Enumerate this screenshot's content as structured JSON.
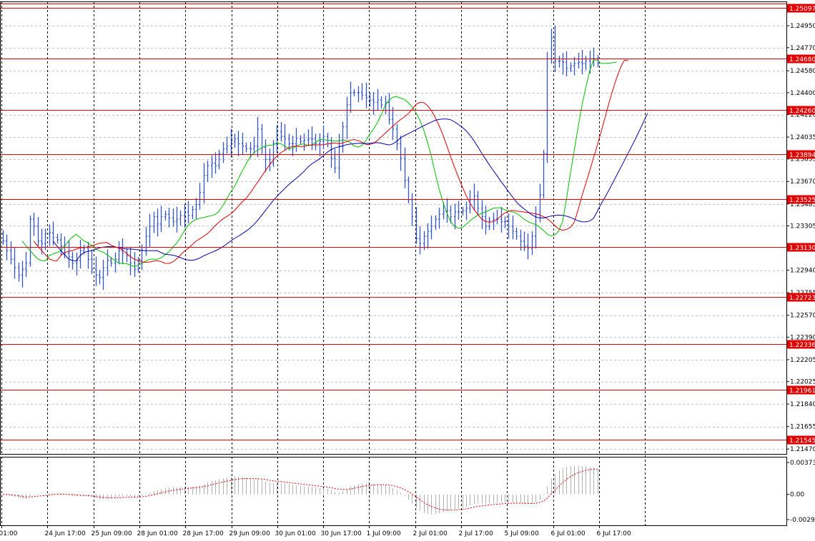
{
  "chart_data": [
    {
      "type": "candlestick",
      "y_ticks": [
        "1.24950",
        "1.24770",
        "1.24580",
        "1.24400",
        "1.24220",
        "1.24035",
        "1.23855",
        "1.23670",
        "1.23485",
        "1.23305",
        "1.22940",
        "1.22755",
        "1.22570",
        "1.22390",
        "1.22205",
        "1.22025",
        "1.21840",
        "1.21655",
        "1.21470"
      ],
      "levels": [
        "1.25097",
        "1.24680",
        "1.24260",
        "1.23894",
        "1.23525",
        "1.23130",
        "1.22723",
        "1.22336",
        "1.21961",
        "1.21545"
      ],
      "ylim": [
        1.2143,
        1.2515
      ],
      "x_ticks": [
        "01:00",
        "24 Jun 17:00",
        "25 Jun 09:00",
        "28 Jun 01:00",
        "28 Jun 17:00",
        "29 Jun 09:00",
        "30 Jun 01:00",
        "30 Jun 17:00",
        "1 Jul 09:00",
        "2 Jul 01:00",
        "2 Jul 17:00",
        "5 Jul 09:00",
        "6 Jul 01:00",
        "6 Jul 17:00"
      ],
      "close": [
        1.2318,
        1.231,
        1.2303,
        1.2296,
        1.229,
        1.2295,
        1.23,
        1.2336,
        1.233,
        1.2318,
        1.2316,
        1.2324,
        1.2325,
        1.2321,
        1.2319,
        1.2314,
        1.2308,
        1.2305,
        1.23,
        1.2302,
        1.231,
        1.2312,
        1.2303,
        1.2295,
        1.229,
        1.2288,
        1.2296,
        1.2302,
        1.23,
        1.2303,
        1.231,
        1.2308,
        1.2306,
        1.23,
        1.2295,
        1.2302,
        1.231,
        1.2322,
        1.233,
        1.2338,
        1.2332,
        1.2338,
        1.234,
        1.2337,
        1.2334,
        1.2336,
        1.2339,
        1.2342,
        1.2339,
        1.2344,
        1.2348,
        1.2358,
        1.2372,
        1.238,
        1.2382,
        1.238,
        1.239,
        1.2394,
        1.2396,
        1.24,
        1.2402,
        1.2398,
        1.2396,
        1.2394,
        1.2394,
        1.2396,
        1.241,
        1.2395,
        1.2385,
        1.2382,
        1.2398,
        1.2408,
        1.2404,
        1.2402,
        1.2398,
        1.2398,
        1.2402,
        1.24,
        1.2401,
        1.2402,
        1.2402,
        1.2398,
        1.24,
        1.2404,
        1.2398,
        1.2386,
        1.2378,
        1.2396,
        1.2412,
        1.243,
        1.244,
        1.244,
        1.244,
        1.2438,
        1.2436,
        1.2434,
        1.2432,
        1.2434,
        1.243,
        1.2432,
        1.2418,
        1.241,
        1.2398,
        1.2386,
        1.2368,
        1.2352,
        1.2338,
        1.232,
        1.2316,
        1.2322,
        1.2326,
        1.233,
        1.2336,
        1.234,
        1.2342,
        1.2343,
        1.2338,
        1.2342,
        1.2342,
        1.2343,
        1.2345,
        1.2352,
        1.2355,
        1.2345,
        1.2338,
        1.233,
        1.2335,
        1.2336,
        1.2336,
        1.2334,
        1.2334,
        1.233,
        1.2326,
        1.2322,
        1.2318,
        1.2314,
        1.2312,
        1.2322,
        1.234,
        1.2356,
        1.239,
        1.2468,
        1.2485,
        1.2466,
        1.2466,
        1.2465,
        1.246,
        1.2462,
        1.2464,
        1.2465,
        1.2464,
        1.2466,
        1.2468,
        1.2468,
        1.2464
      ],
      "indicator_ticks": [
        "0.003733",
        "0.00",
        "-0.002943"
      ]
    }
  ]
}
